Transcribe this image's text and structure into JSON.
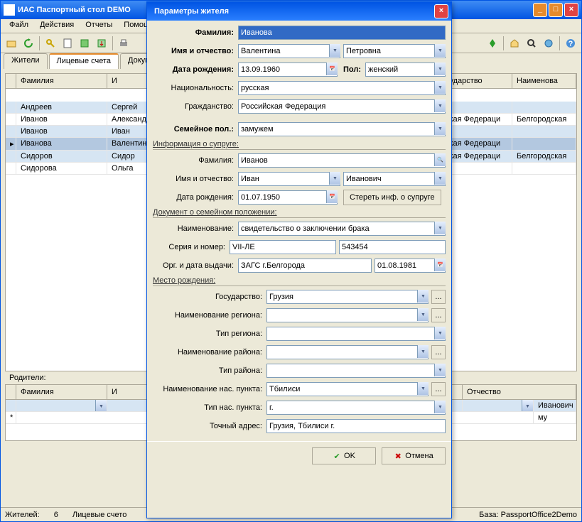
{
  "mainWindow": {
    "title": "ИАС Паспортный стол DEMO",
    "menu": [
      "Файл",
      "Действия",
      "Отчеты",
      "Помощь"
    ],
    "tabs": [
      "Жители",
      "Лицевые счета",
      "Документы"
    ]
  },
  "grid": {
    "cols": [
      "Фамилия",
      "И",
      "сударство",
      "Наименова"
    ],
    "rows": [
      {
        "a": "Андреев",
        "b": "Сергей",
        "c": "",
        "d": ""
      },
      {
        "a": "Иванов",
        "b": "Александр",
        "c": "ская Федераци",
        "d": "Белгородская"
      },
      {
        "a": "Иванов",
        "b": "Иван",
        "c": "",
        "d": ""
      },
      {
        "a": "Иванова",
        "b": "Валентина",
        "c": "ская Федераци",
        "d": ""
      },
      {
        "a": "Сидоров",
        "b": "Сидор",
        "c": "ская Федераци",
        "d": "Белгородская"
      },
      {
        "a": "Сидорова",
        "b": "Ольга",
        "c": "",
        "d": ""
      }
    ]
  },
  "parentsLabel": "Родители:",
  "parentsCols": [
    "Фамилия",
    "И",
    "Отчество"
  ],
  "parentsRow": {
    "c": "Иванович",
    "d": "му"
  },
  "status": {
    "a": "Жителей:",
    "an": "6",
    "b": "Лицевые счето",
    "c": "База: PassportOffice2Demo"
  },
  "dialog": {
    "title": "Параметры жителя",
    "surname": {
      "label": "Фамилия:",
      "value": "Иванова"
    },
    "name": {
      "label": "Имя и отчество:",
      "first": "Валентина",
      "middle": "Петровна"
    },
    "dob": {
      "label": "Дата рождения:",
      "value": "13.09.1960"
    },
    "sex": {
      "label": "Пол:",
      "value": "женский"
    },
    "nat": {
      "label": "Национальность:",
      "value": "русская"
    },
    "cit": {
      "label": "Гражданство:",
      "value": "Российская Федерация"
    },
    "marital": {
      "label": "Семейное пол.:",
      "value": "замужем"
    },
    "spouseGroup": "Информация о супруге:",
    "spSurname": {
      "label": "Фамилия:",
      "value": "Иванов"
    },
    "spName": {
      "label": "Имя и отчество:",
      "first": "Иван",
      "middle": "Иванович"
    },
    "spDob": {
      "label": "Дата рождения:",
      "value": "01.07.1950"
    },
    "spClear": "Стереть инф. о супруге",
    "docGroup": "Документ о семейном положении:",
    "docName": {
      "label": "Наименование:",
      "value": "свидетельство о заключении брака"
    },
    "docSer": {
      "label": "Серия и номер:",
      "a": "VII-ЛЕ",
      "b": "543454"
    },
    "docOrg": {
      "label": "Орг. и дата выдачи:",
      "org": "ЗАГС г.Белгорода",
      "date": "01.08.1981"
    },
    "birthGroup": "Место рождения:",
    "state": {
      "label": "Государство:",
      "value": "Грузия"
    },
    "regName": {
      "label": "Наименование региона:",
      "value": ""
    },
    "regType": {
      "label": "Тип региона:",
      "value": ""
    },
    "distName": {
      "label": "Наименование района:",
      "value": ""
    },
    "distType": {
      "label": "Тип района:",
      "value": ""
    },
    "townName": {
      "label": "Наименование нас. пункта:",
      "value": "Тбилиси"
    },
    "townType": {
      "label": "Тип нас. пункта:",
      "value": "г."
    },
    "addr": {
      "label": "Точный адрес:",
      "value": "Грузия, Тбилиси г."
    },
    "ok": "OK",
    "cancel": "Отмена"
  }
}
